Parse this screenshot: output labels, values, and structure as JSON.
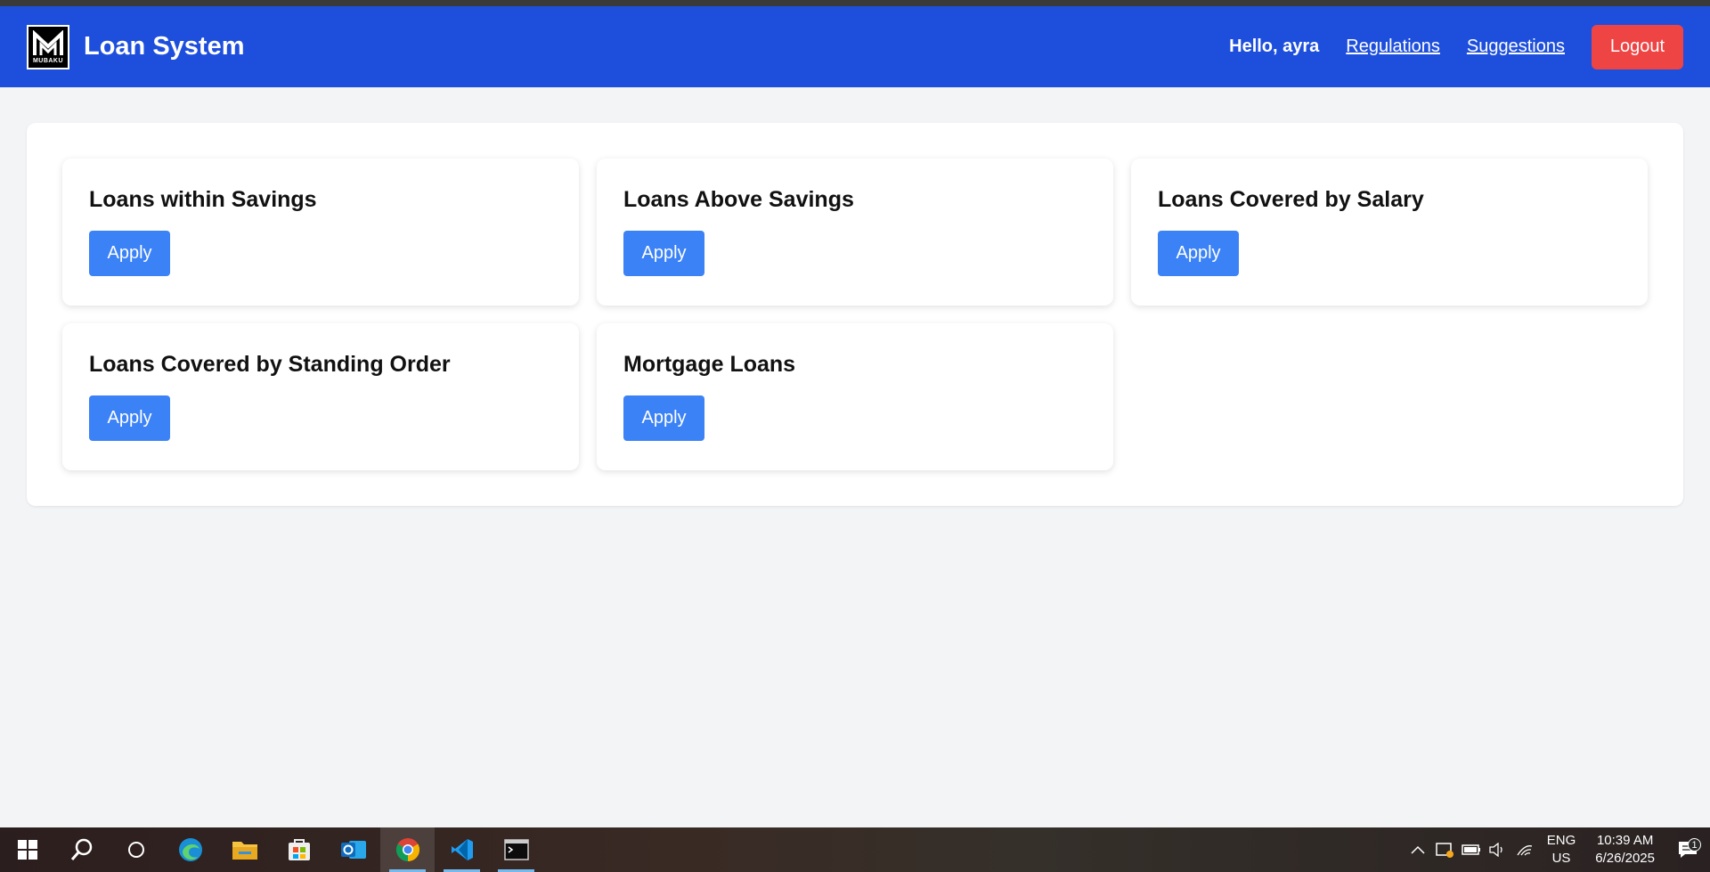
{
  "navbar": {
    "logo_text": "MUBAKU",
    "title": "Loan System",
    "greeting": "Hello, ayra",
    "links": [
      "Regulations",
      "Suggestions"
    ],
    "logout_label": "Logout"
  },
  "loans": [
    {
      "title": "Loans within Savings",
      "button": "Apply"
    },
    {
      "title": "Loans Above Savings",
      "button": "Apply"
    },
    {
      "title": "Loans Covered by Salary",
      "button": "Apply"
    },
    {
      "title": "Loans Covered by Standing Order",
      "button": "Apply"
    },
    {
      "title": "Mortgage Loans",
      "button": "Apply"
    }
  ],
  "taskbar": {
    "apps": [
      "windows-start-icon",
      "search-icon",
      "task-view-icon",
      "edge-icon",
      "file-explorer-icon",
      "store-icon",
      "outlook-icon",
      "chrome-icon",
      "vscode-icon",
      "terminal-icon"
    ],
    "lang_primary": "ENG",
    "lang_secondary": "US",
    "time": "10:39 AM",
    "date": "6/26/2025",
    "notification_count": "1"
  },
  "colors": {
    "navbar": "#1e4fdc",
    "apply_button": "#3b82f6",
    "logout_button": "#ef4444",
    "page_background": "#f3f4f6"
  }
}
